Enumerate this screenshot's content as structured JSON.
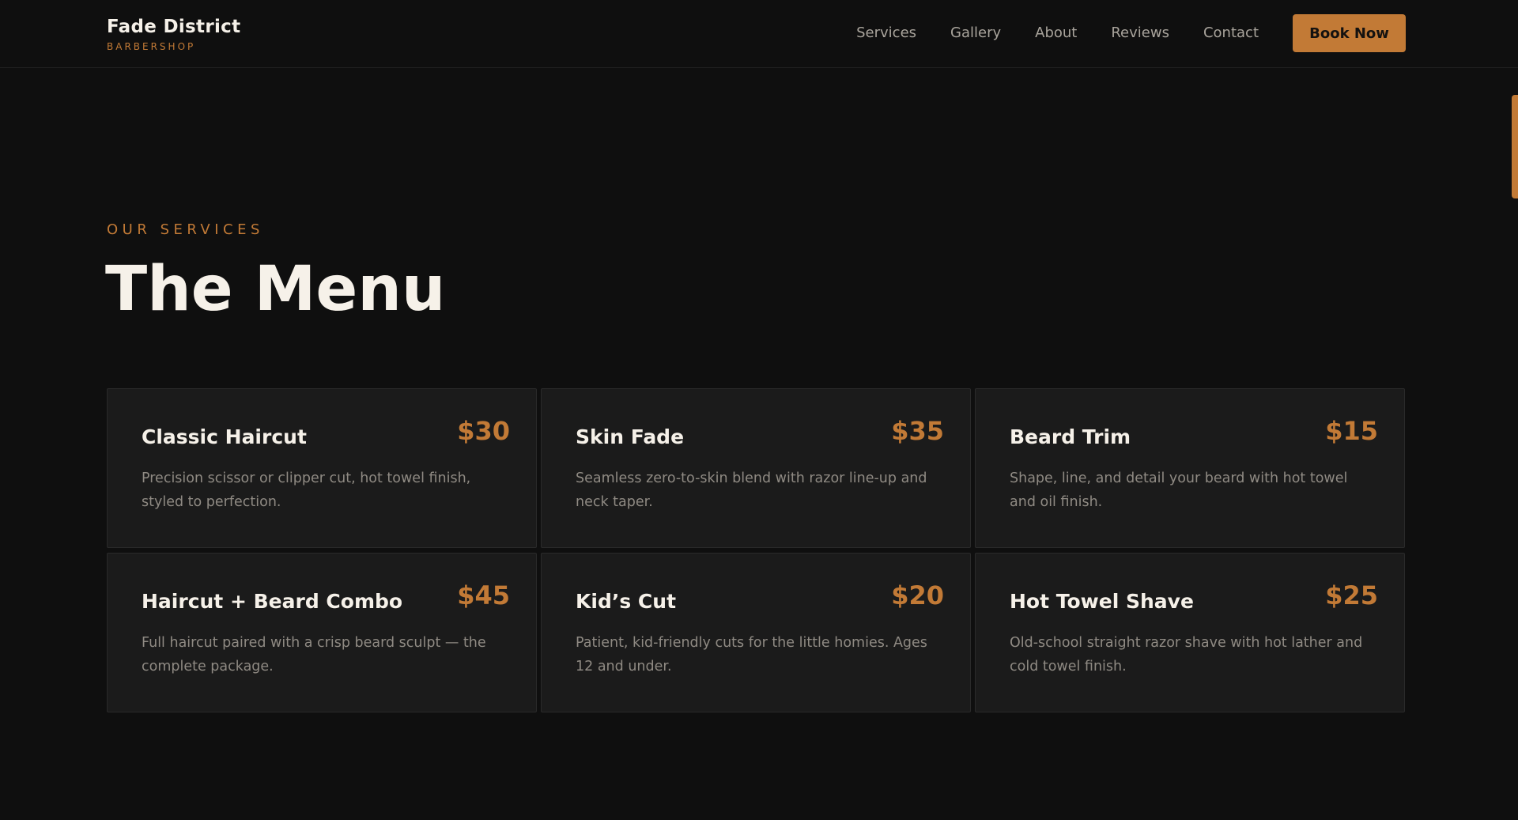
{
  "header": {
    "brand_name": "Fade District",
    "brand_sub": "BARBERSHOP",
    "nav": [
      "Services",
      "Gallery",
      "About",
      "Reviews",
      "Contact"
    ],
    "cta": "Book Now"
  },
  "section": {
    "eyebrow": "OUR SERVICES",
    "title": "The Menu"
  },
  "services": [
    {
      "name": "Classic Haircut",
      "price": "$30",
      "desc": "Precision scissor or clipper cut, hot towel finish, styled to perfection."
    },
    {
      "name": "Skin Fade",
      "price": "$35",
      "desc": "Seamless zero-to-skin blend with razor line-up and neck taper."
    },
    {
      "name": "Beard Trim",
      "price": "$15",
      "desc": "Shape, line, and detail your beard with hot towel and oil finish."
    },
    {
      "name": "Haircut + Beard Combo",
      "price": "$45",
      "desc": "Full haircut paired with a crisp beard sculpt — the complete package."
    },
    {
      "name": "Kid’s Cut",
      "price": "$20",
      "desc": "Patient, kid-friendly cuts for the little homies. Ages 12 and under."
    },
    {
      "name": "Hot Towel Shave",
      "price": "$25",
      "desc": "Old-school straight razor shave with hot lather and cold towel finish."
    }
  ],
  "colors": {
    "accent": "#c27a36",
    "background": "#0f0f0f",
    "card": "#1b1b1b"
  }
}
